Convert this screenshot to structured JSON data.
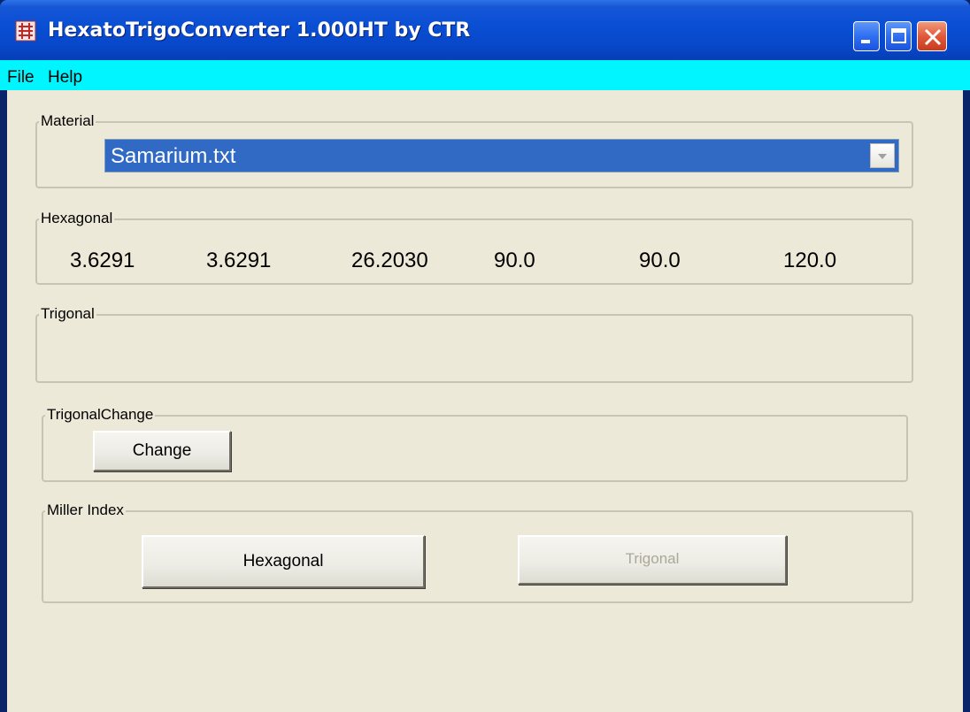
{
  "window": {
    "title": "HexatoTrigoConverter 1.000HT by CTR",
    "icon": "app-icon"
  },
  "menu": {
    "items": [
      "File",
      "Help"
    ]
  },
  "material": {
    "label": "Material",
    "selected": "Samarium.txt"
  },
  "hexagonal": {
    "label": "Hexagonal",
    "values": [
      "3.6291",
      "3.6291",
      "26.2030",
      "90.0",
      "90.0",
      "120.0"
    ]
  },
  "trigonal": {
    "label": "Trigonal"
  },
  "trigonal_change": {
    "label": "TrigonalChange",
    "button": "Change"
  },
  "miller_index": {
    "label": "Miller Index",
    "hex_button": "Hexagonal",
    "trig_button": "Trigonal"
  },
  "colors": {
    "menubar": "#00f5ff",
    "selection": "#316ac5",
    "client": "#ece9d8"
  }
}
